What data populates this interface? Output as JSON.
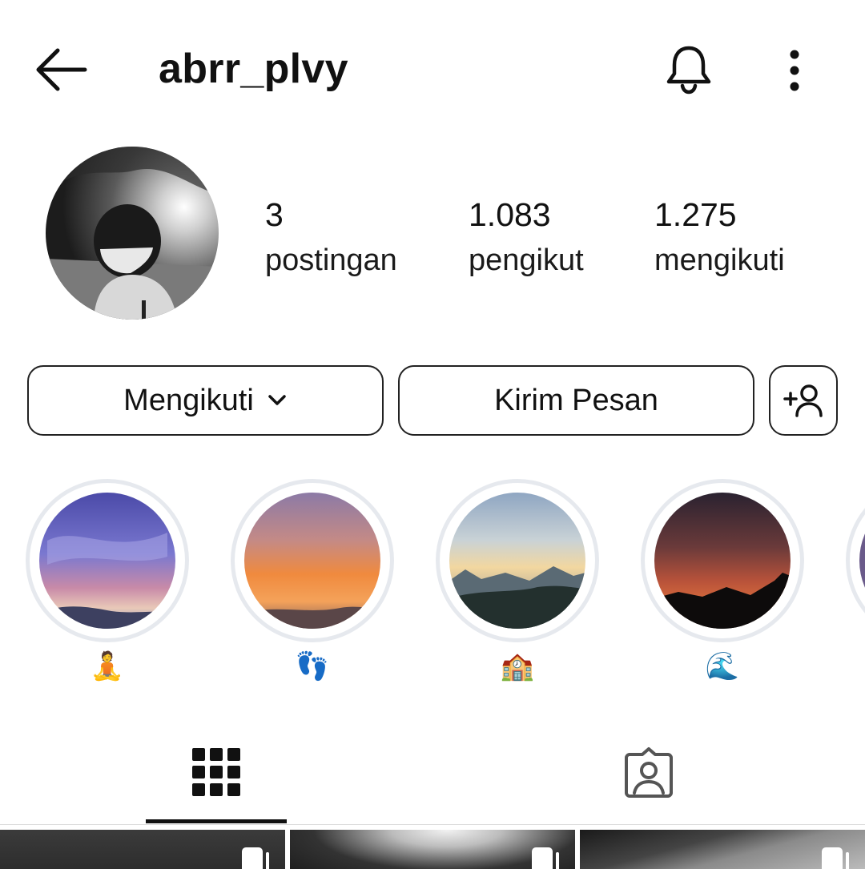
{
  "header": {
    "username": "abrr_plvy"
  },
  "stats": [
    {
      "value": "3",
      "label": "postingan"
    },
    {
      "value": "1.083",
      "label": "pengikut"
    },
    {
      "value": "1.275",
      "label": "mengikuti"
    }
  ],
  "actions": {
    "following_label": "Mengikuti",
    "message_label": "Kirim Pesan"
  },
  "highlights": [
    {
      "caption": "🧘"
    },
    {
      "caption": "👣"
    },
    {
      "caption": "🏫"
    },
    {
      "caption": "🌊"
    }
  ],
  "tabs": {
    "active": "posts-grid"
  },
  "icons": {
    "back": "arrow-left-icon",
    "notifications": "bell-icon",
    "more": "more-vertical-icon",
    "add_user": "add-user-icon",
    "grid": "grid-icon",
    "tagged": "tagged-person-icon"
  },
  "colors": {
    "text": "#111111",
    "highlight_ring": "#e6e9ee",
    "border": "#222222"
  }
}
